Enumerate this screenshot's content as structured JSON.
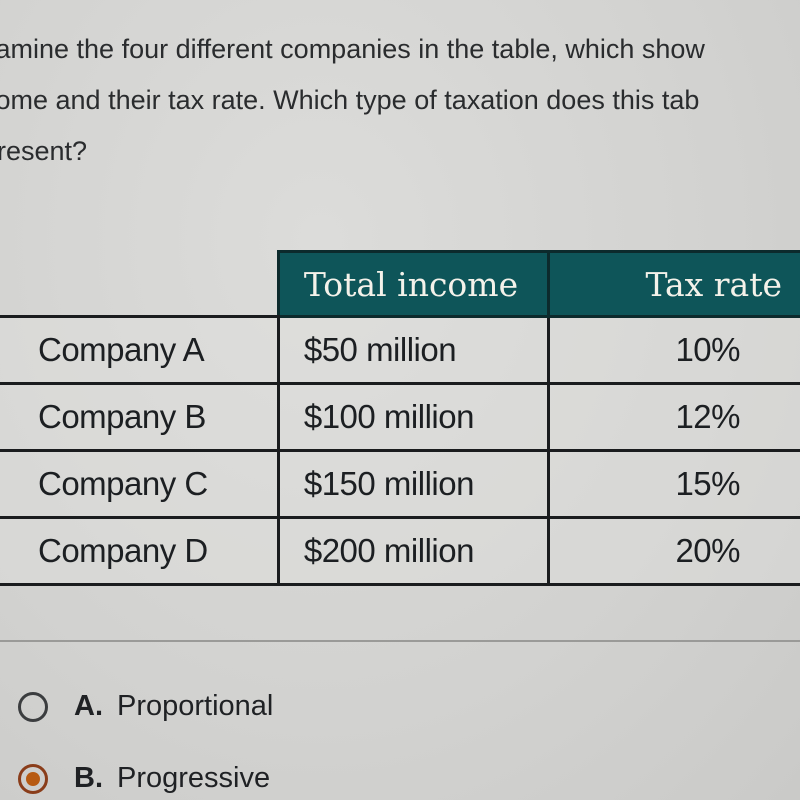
{
  "question": {
    "lines": [
      "xamine the four different companies in the table, which show",
      "come and their tax rate. Which type of taxation does this tab",
      "present?"
    ]
  },
  "table": {
    "headers": [
      "",
      "Total income",
      "Tax rate"
    ],
    "rows": [
      {
        "company": "Company A",
        "income": "$50 million",
        "rate": "10%"
      },
      {
        "company": "Company B",
        "income": "$100 million",
        "rate": "12%"
      },
      {
        "company": "Company C",
        "income": "$150 million",
        "rate": "15%"
      },
      {
        "company": "Company D",
        "income": "$200 million",
        "rate": "20%"
      }
    ],
    "header_color": "#0e5559"
  },
  "options": [
    {
      "letter": "A.",
      "label": "Proportional",
      "selected": false
    },
    {
      "letter": "B.",
      "label": "Progressive",
      "selected": true
    }
  ],
  "colors": {
    "selected_radio": "#b75a12"
  }
}
